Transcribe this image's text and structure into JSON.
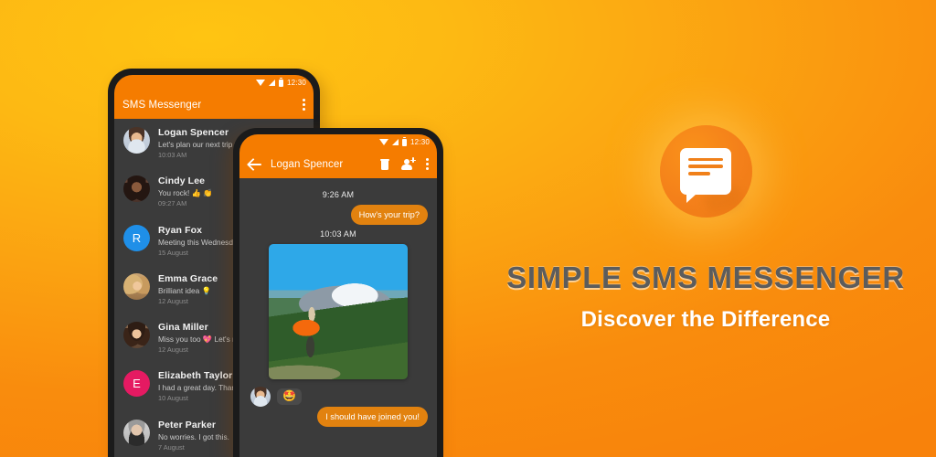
{
  "background": {
    "top_color": "#FFC412",
    "bottom_color": "#F8820B"
  },
  "branding": {
    "logo_icon": "message-bubble-icon",
    "title": "SIMPLE SMS MESSENGER",
    "subtitle": "Discover the Difference",
    "title_color": "#5C5C5C",
    "subtitle_color": "#FFFFFF",
    "accent_color": "#F4801A"
  },
  "phone_list": {
    "statusbar": {
      "wifi_icon": "wifi-icon",
      "signal_icon": "signal-icon",
      "battery_icon": "battery-icon",
      "clock": "12:30"
    },
    "appbar": {
      "title": "SMS Messenger",
      "overflow_icon": "kebab-menu-icon"
    },
    "conversations": [
      {
        "name": "Logan Spencer",
        "snippet": "Let's plan our next trip tog",
        "date": "10:03 AM",
        "avatar_type": "photo",
        "avatar_color": "#E8DCCB",
        "initial": ""
      },
      {
        "name": "Cindy Lee",
        "snippet": "You rock! 👍 👏",
        "date": "09:27 AM",
        "avatar_type": "photo",
        "avatar_color": "#6B4A3A",
        "initial": ""
      },
      {
        "name": "Ryan Fox",
        "snippet": "Meeting this Wednesday",
        "date": "15 August",
        "avatar_type": "initial",
        "avatar_color": "#1F8FE8",
        "initial": "R"
      },
      {
        "name": "Emma Grace",
        "snippet": "Brilliant idea 💡",
        "date": "12 August",
        "avatar_type": "photo",
        "avatar_color": "#C9A271",
        "initial": ""
      },
      {
        "name": "Gina Miller",
        "snippet": "Miss you too 💖  Let's me",
        "date": "12 August",
        "avatar_type": "photo",
        "avatar_color": "#8C6A4F",
        "initial": ""
      },
      {
        "name": "Elizabeth Taylor",
        "snippet": "I had a great day. Thanks",
        "date": "10 August",
        "avatar_type": "initial",
        "avatar_color": "#E51A62",
        "initial": "E"
      },
      {
        "name": "Peter Parker",
        "snippet": "No worries. I got this.",
        "date": "7 August",
        "avatar_type": "photo",
        "avatar_color": "#BFBFBF",
        "initial": ""
      }
    ]
  },
  "phone_chat": {
    "statusbar": {
      "wifi_icon": "wifi-icon",
      "signal_icon": "signal-icon",
      "battery_icon": "battery-icon",
      "clock": "12:30"
    },
    "appbar": {
      "back_icon": "back-arrow-icon",
      "title": "Logan Spencer",
      "delete_icon": "trash-icon",
      "add_contact_icon": "add-person-icon",
      "overflow_icon": "kebab-menu-icon"
    },
    "messages": [
      {
        "kind": "timestamp",
        "text": "9:26 AM"
      },
      {
        "kind": "outgoing",
        "text": "How's your trip?"
      },
      {
        "kind": "timestamp",
        "text": "10:03 AM"
      },
      {
        "kind": "image",
        "alt": "hiker-with-orange-backpack-mountain-photo"
      },
      {
        "kind": "reaction",
        "emoji": "🤩",
        "avatar": "logan-spencer-avatar"
      },
      {
        "kind": "outgoing",
        "text": "I should have joined you!"
      }
    ],
    "bubble_color": "#E2820F"
  }
}
